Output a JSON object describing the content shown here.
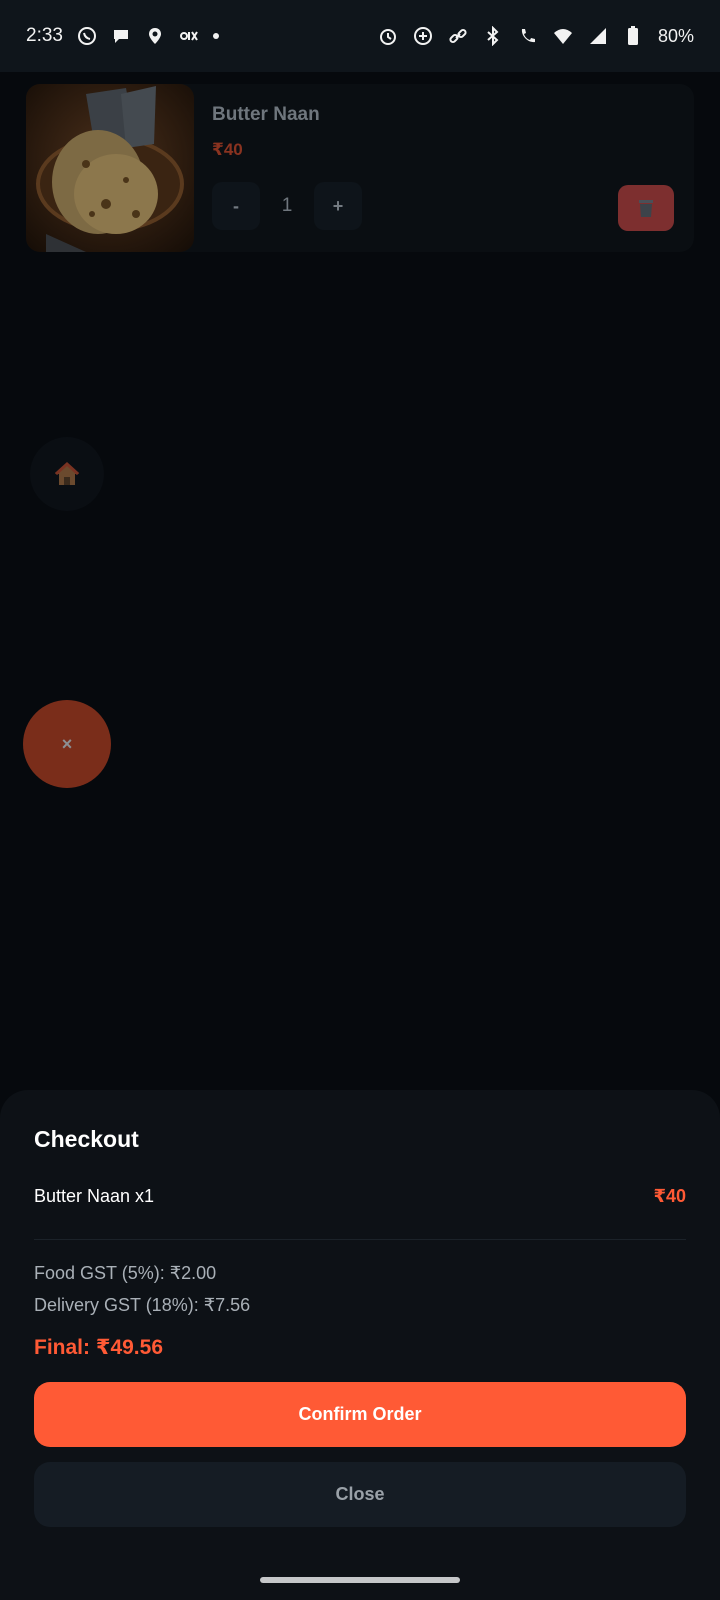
{
  "status_bar": {
    "time": "2:33",
    "battery": "80%",
    "left_icons": [
      "whatsapp-icon",
      "chat-icon",
      "location-pin-icon",
      "olx-icon",
      "dot-icon"
    ],
    "right_icons": [
      "alarm-icon",
      "data-saver-icon",
      "link-icon",
      "bluetooth-icon",
      "wifi-calling-icon",
      "wifi-icon",
      "signal-icon",
      "battery-icon"
    ]
  },
  "cart": {
    "items": [
      {
        "name": "Butter Naan",
        "price": "₹40",
        "quantity": "1",
        "decrement_label": "-",
        "increment_label": "+",
        "image_icon": "butter-naan-photo",
        "delete_icon": "trash-icon"
      }
    ]
  },
  "fabs": {
    "home_icon": "home-icon",
    "close_label": "×"
  },
  "checkout": {
    "title": "Checkout",
    "line_items": [
      {
        "name": "Butter Naan x1",
        "price": "₹40"
      }
    ],
    "food_gst": "Food GST (5%): ₹2.00",
    "delivery_gst": "Delivery GST (18%): ₹7.56",
    "final": "Final: ₹49.56",
    "confirm_label": "Confirm Order",
    "close_label": "Close"
  },
  "colors": {
    "accent": "#ff5a35",
    "background": "#06090d",
    "sheet": "#0d1116",
    "delete_button": "#7d2f2f"
  }
}
